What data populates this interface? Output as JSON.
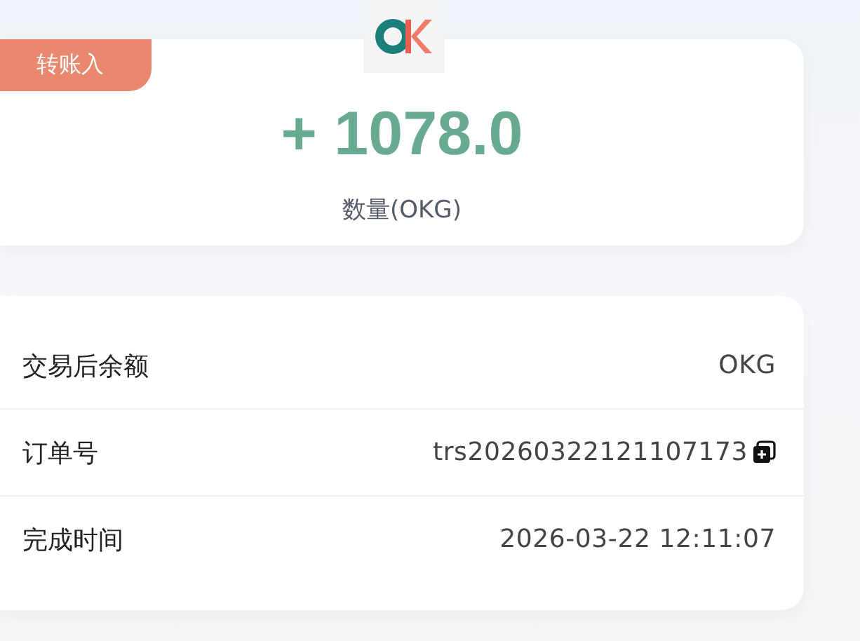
{
  "summary": {
    "badge": "转账入",
    "amount": "+ 1078.0",
    "unit_label": "数量(OKG)"
  },
  "details": [
    {
      "label": "交易后余额",
      "value": "OKG",
      "copyable": false
    },
    {
      "label": "订单号",
      "value": "trs20260322121107173",
      "copyable": true
    },
    {
      "label": "完成时间",
      "value": "2026-03-22 12:11:07",
      "copyable": false
    }
  ]
}
